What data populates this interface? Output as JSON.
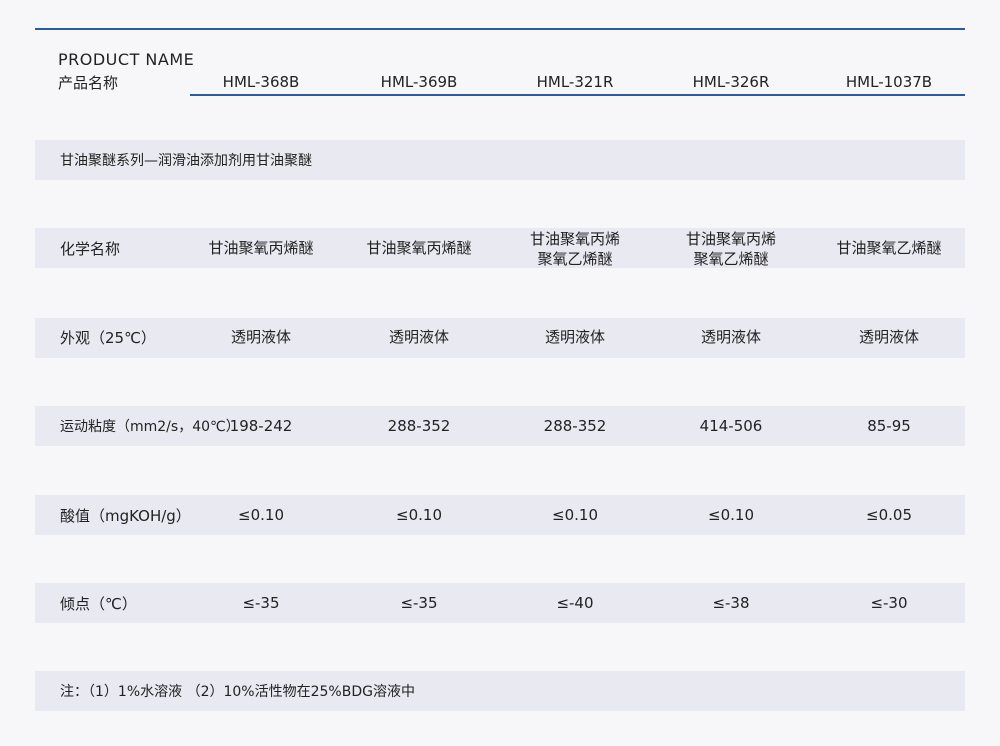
{
  "header": {
    "product_name_en": "PRODUCT NAME",
    "product_name_zh": "产品名称",
    "products": [
      "HML-368B",
      "HML-369B",
      "HML-321R",
      "HML-326R",
      "HML-1037B"
    ]
  },
  "series_title": "甘油聚醚系列—润滑油添加剂用甘油聚醚",
  "rows": {
    "chem_name": {
      "label": "化学名称",
      "values": [
        [
          "甘油聚氧丙烯醚"
        ],
        [
          "甘油聚氧丙烯醚"
        ],
        [
          "甘油聚氧丙烯",
          "聚氧乙烯醚"
        ],
        [
          "甘油聚氧丙烯",
          "聚氧乙烯醚"
        ],
        [
          "甘油聚氧乙烯醚"
        ]
      ]
    },
    "appearance": {
      "label": "外观（25℃）",
      "values": [
        "透明液体",
        "透明液体",
        "透明液体",
        "透明液体",
        "透明液体"
      ]
    },
    "viscosity": {
      "label": "运动粘度（mm2/s，40℃）",
      "values": [
        "198-242",
        "288-352",
        "288-352",
        "414-506",
        "85-95"
      ]
    },
    "acid": {
      "label": "酸值（mgKOH/g）",
      "values": [
        "≤0.10",
        "≤0.10",
        "≤0.10",
        "≤0.10",
        "≤0.05"
      ]
    },
    "pour_point": {
      "label": "倾点（℃）",
      "values": [
        "≤-35",
        "≤-35",
        "≤-40",
        "≤-38",
        "≤-30"
      ]
    }
  },
  "note": "注：（1）1%水溶液 （2）10%活性物在25%BDG溶液中",
  "colors": {
    "accent": "#2b5a9e",
    "band": "#e9e9f2",
    "background": "#f7f7f9"
  }
}
